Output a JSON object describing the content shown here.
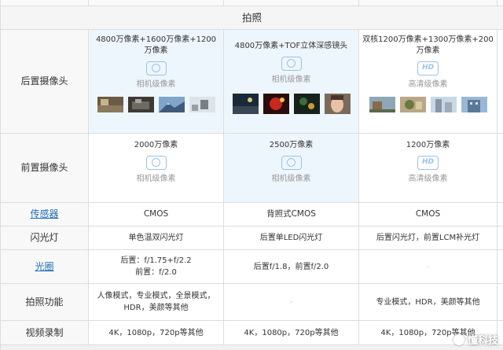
{
  "section": {
    "title": "拍照"
  },
  "rows": {
    "rear": {
      "label": "后置摄像头",
      "col1": {
        "spec": "4800万像素+1600万像素+1200万像素",
        "icon": "camera-lens-icon",
        "sub": "相机级像素"
      },
      "col2": {
        "spec": "4800万像素+TOF立体深感镜头",
        "icon": "camera-lens-icon",
        "sub": "相机级像素"
      },
      "col3": {
        "spec": "双核1200万像素+1300万像素+200万像素",
        "icon": "hd-icon",
        "icon_text": "HD",
        "sub": "高清级像素"
      }
    },
    "front": {
      "label": "前置摄像头",
      "col1": {
        "spec": "2000万像素",
        "icon": "camera-lens-icon",
        "sub": "相机级像素"
      },
      "col2": {
        "spec": "2500万像素",
        "icon": "camera-lens-icon",
        "sub": "相机级像素"
      },
      "col3": {
        "spec": "1200万像素",
        "icon": "hd-icon",
        "icon_text": "HD",
        "sub": "高清级像素"
      }
    },
    "sensor": {
      "label": "传感器",
      "col1": "CMOS",
      "col2": "背照式CMOS",
      "col3": "CMOS"
    },
    "flash": {
      "label": "闪光灯",
      "col1": "单色温双闪光灯",
      "col2": "后置单LED闪光灯",
      "col3": "后置闪光灯，前置LCM补光灯"
    },
    "aperture": {
      "label": "光圈",
      "col1_line1": "后置：f/1.75+f/2.2",
      "col1_line2": "前置：f/2.0",
      "col2": "后置f/1.8，前置f/2.0",
      "col3": "-"
    },
    "features": {
      "label": "拍照功能",
      "col1": "人像模式，专业模式，全景模式，HDR，美颜等其他",
      "col2": "-",
      "col3": "专业模式，HDR，美颜等其他"
    },
    "video": {
      "label": "视频录制",
      "col1": "4K，1080p，720p等其他",
      "col2": "4K，1080p，720p等其他",
      "col3": "4K，1080p，720p等其他"
    }
  },
  "watermark": {
    "text": "懂科技"
  },
  "colors": {
    "link": "#1f6bb5",
    "highlight": "#eef6fd",
    "icon": "#9cc1e3"
  }
}
